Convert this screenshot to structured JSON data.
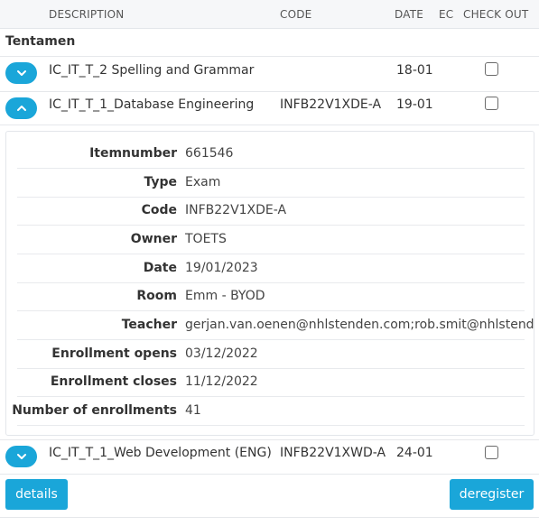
{
  "header": {
    "description": "DESCRIPTION",
    "code": "CODE",
    "date": "DATE",
    "ec": "EC",
    "checkout": "CHECK OUT"
  },
  "group_label": "Tentamen",
  "rows": [
    {
      "description": "IC_IT_T_2 Spelling and Grammar",
      "code": "",
      "date": "18-01",
      "expanded": false
    },
    {
      "description": "IC_IT_T_1_Database Engineering",
      "code": "INFB22V1XDE-A",
      "date": "19-01",
      "expanded": true
    },
    {
      "description": "IC_IT_T_1_Web Development (ENG)",
      "code": "INFB22V1XWD-A",
      "date": "24-01",
      "expanded": false
    }
  ],
  "details": [
    {
      "label": "Itemnumber",
      "value": "661546"
    },
    {
      "label": "Type",
      "value": "Exam"
    },
    {
      "label": "Code",
      "value": "INFB22V1XDE-A"
    },
    {
      "label": "Owner",
      "value": "TOETS"
    },
    {
      "label": "Date",
      "value": "19/01/2023"
    },
    {
      "label": "Room",
      "value": "Emm - BYOD"
    },
    {
      "label": "Teacher",
      "value": "gerjan.van.oenen@nhlstenden.com;rob.smit@nhlstende"
    },
    {
      "label": "Enrollment opens",
      "value": "03/12/2022"
    },
    {
      "label": "Enrollment closes",
      "value": "11/12/2022"
    },
    {
      "label": "Number of enrollments",
      "value": "41"
    }
  ],
  "buttons": {
    "details": "details",
    "deregister": "deregister"
  },
  "colors": {
    "accent": "#1aa6d9",
    "header_bg": "#f6f7f9",
    "border": "#e6e8eb"
  },
  "icons": {
    "collapsed": "chevron-down-icon",
    "expanded": "chevron-up-icon"
  }
}
